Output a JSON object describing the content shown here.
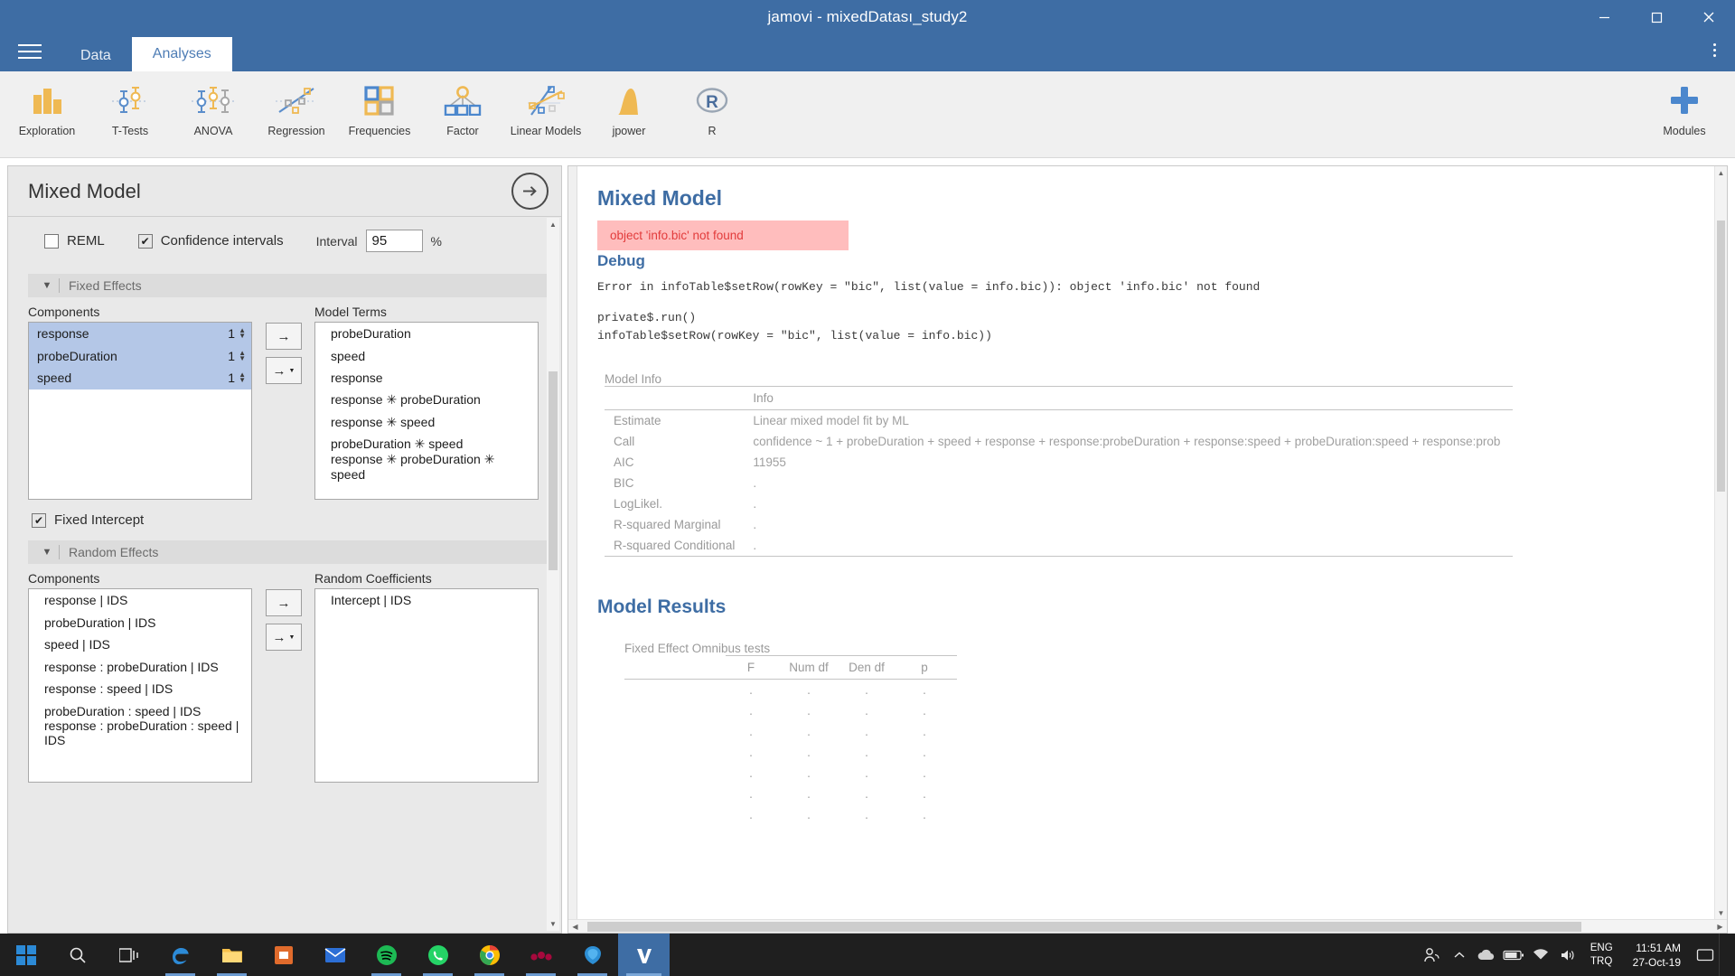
{
  "window": {
    "title": "jamovi - mixedDatası_study2",
    "minimize_label": "─",
    "maximize_label": "☐",
    "close_label": "✕"
  },
  "tabs": {
    "menu_icon": "hamburger-icon",
    "items": [
      {
        "label": "Data",
        "active": false
      },
      {
        "label": "Analyses",
        "active": true
      }
    ],
    "overflow_icon": "kebab-menu-icon"
  },
  "ribbon": {
    "items": [
      {
        "label": "Exploration",
        "icon": "bar-chart-icon"
      },
      {
        "label": "T-Tests",
        "icon": "t-test-icon"
      },
      {
        "label": "ANOVA",
        "icon": "anova-icon"
      },
      {
        "label": "Regression",
        "icon": "scatter-regression-icon"
      },
      {
        "label": "Frequencies",
        "icon": "squares-grid-icon"
      },
      {
        "label": "Factor",
        "icon": "factor-tree-icon"
      },
      {
        "label": "Linear Models",
        "icon": "linear-models-icon"
      },
      {
        "label": "jpower",
        "icon": "power-curve-icon"
      },
      {
        "label": "R",
        "icon": "r-logo-icon"
      }
    ],
    "modules": {
      "label": "Modules",
      "icon": "modules-plus-icon"
    }
  },
  "options": {
    "title": "Mixed Model",
    "collapse_icon": "arrow-right-circle-icon",
    "reml": {
      "label": "REML",
      "checked": false
    },
    "confidence_intervals": {
      "label": "Confidence intervals",
      "checked": true
    },
    "interval": {
      "label": "Interval",
      "value": "95",
      "suffix": "%"
    },
    "fixed_effects": {
      "section_label": "Fixed Effects",
      "components_label": "Components",
      "components": [
        {
          "name": "response",
          "level": "1",
          "selected": true
        },
        {
          "name": "probeDuration",
          "level": "1",
          "selected": true
        },
        {
          "name": "speed",
          "level": "1",
          "selected": true
        }
      ],
      "model_terms_label": "Model Terms",
      "model_terms": [
        "probeDuration",
        "speed",
        "response",
        "response ✳ probeDuration",
        "response ✳ speed",
        "probeDuration ✳ speed",
        "response ✳ probeDuration ✳ speed"
      ],
      "add_button": "→",
      "add_menu_button": "→"
    },
    "fixed_intercept": {
      "label": "Fixed Intercept",
      "checked": true
    },
    "random_effects": {
      "section_label": "Random Effects",
      "components_label": "Components",
      "components": [
        "response | IDS",
        "probeDuration | IDS",
        "speed | IDS",
        "response : probeDuration | IDS",
        "response : speed | IDS",
        "probeDuration : speed | IDS",
        "response : probeDuration : speed | IDS"
      ],
      "coefficients_label": "Random Coefficients",
      "coefficients": [
        "Intercept | IDS"
      ],
      "add_button": "→",
      "add_menu_button": "→"
    }
  },
  "results": {
    "title": "Mixed Model",
    "error_banner": "object 'info.bic' not found",
    "debug_heading": "Debug",
    "debug_line1": "Error in infoTable$setRow(rowKey = \"bic\", list(value = info.bic)): object 'info.bic' not found",
    "debug_line2": "private$.run()",
    "debug_line3": "infoTable$setRow(rowKey = \"bic\", list(value = info.bic))",
    "model_info": {
      "caption": "Model Info",
      "column_header": "Info",
      "rows": [
        {
          "label": "Estimate",
          "value": "Linear mixed model fit by ML"
        },
        {
          "label": "Call",
          "value": "confidence ~ 1 + probeDuration + speed + response + response:probeDuration + response:speed + probeDuration:speed + response:prob"
        },
        {
          "label": "AIC",
          "value": "11955"
        },
        {
          "label": "BIC",
          "value": "."
        },
        {
          "label": "LogLikel.",
          "value": "."
        },
        {
          "label": "R-squared Marginal",
          "value": "."
        },
        {
          "label": "R-squared Conditional",
          "value": "."
        }
      ]
    },
    "model_results_heading": "Model Results",
    "omnibus": {
      "caption": "Fixed Effect Omnibus tests",
      "columns": [
        "F",
        "Num df",
        "Den df",
        "p"
      ],
      "rows": [
        [
          ".",
          ".",
          ".",
          "."
        ],
        [
          ".",
          ".",
          ".",
          "."
        ],
        [
          ".",
          ".",
          ".",
          "."
        ],
        [
          ".",
          ".",
          ".",
          "."
        ],
        [
          ".",
          ".",
          ".",
          "."
        ],
        [
          ".",
          ".",
          ".",
          "."
        ],
        [
          ".",
          ".",
          ".",
          "."
        ]
      ]
    }
  },
  "taskbar": {
    "start_icon": "windows-start-icon",
    "search_icon": "search-icon",
    "taskview_icon": "task-view-icon",
    "apps": [
      {
        "name": "edge-icon",
        "color": "#2c8ad6"
      },
      {
        "name": "file-explorer-icon",
        "color": "#f7c04a"
      },
      {
        "name": "microsoft-store-icon",
        "color": "#e06b2c"
      },
      {
        "name": "mail-icon",
        "color": "#2c6fd6"
      },
      {
        "name": "spotify-icon",
        "color": "#1db954"
      },
      {
        "name": "whatsapp-icon",
        "color": "#25d366"
      },
      {
        "name": "chrome-icon",
        "color": "#4285f4"
      },
      {
        "name": "mendeley-icon",
        "color": "#a6093d"
      },
      {
        "name": "thunderbird-icon",
        "color": "#2d8fd5"
      },
      {
        "name": "jamovi-icon",
        "color": "#3e6da4"
      }
    ],
    "tray": {
      "people_icon": "people-icon",
      "chevron_icon": "chevron-up-icon",
      "cloud_icon": "onedrive-cloud-icon",
      "battery_icon": "battery-icon",
      "network_icon": "wifi-icon",
      "volume_icon": "speaker-icon",
      "language_top": "ENG",
      "language_bottom": "TRQ",
      "time": "11:51 AM",
      "date": "27-Oct-19",
      "notification_icon": "notification-icon"
    }
  }
}
